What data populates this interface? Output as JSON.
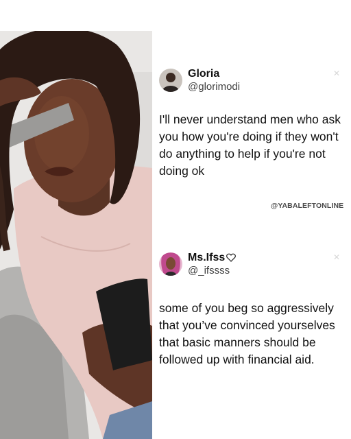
{
  "tweets": [
    {
      "display_name": "Gloria",
      "handle": "@glorimodi",
      "text": "I'll never understand men who ask you how you're doing if they won't do anything to help if you're not doing ok",
      "avatar_icon": "profile-photo"
    },
    {
      "display_name": "Ms.Ifss",
      "handle": "@_ifssss",
      "text": "some of you beg so aggressively that you’ve convinced yourselves that basic manners should be followed up with financial aid.",
      "avatar_icon": "profile-photo",
      "name_icon": "heart-outline-icon"
    }
  ],
  "watermark": "@YABALEFTONLINE",
  "colors": {
    "text": "#111111",
    "handle": "#3f3f3f",
    "background": "#ffffff"
  }
}
